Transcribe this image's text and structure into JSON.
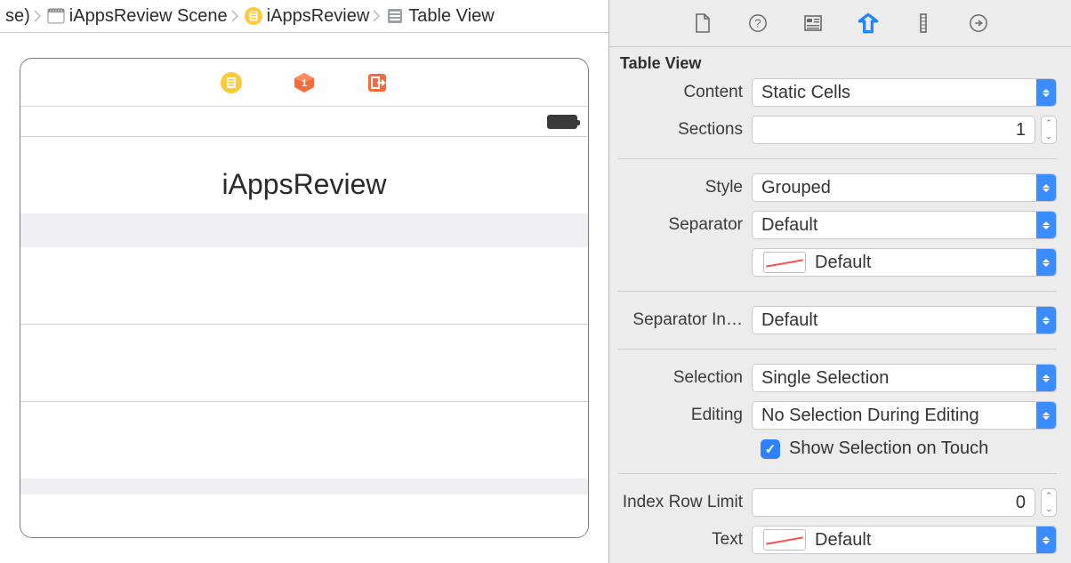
{
  "breadcrumbs": {
    "item0": "se)",
    "item1": "iAppsReview Scene",
    "item2": "iAppsReview",
    "item3": "Table View"
  },
  "scene": {
    "nav_title": "iAppsReview"
  },
  "inspector": {
    "header": "Table View",
    "labels": {
      "content": "Content",
      "sections": "Sections",
      "style": "Style",
      "separator": "Separator",
      "separator_inset": "Separator In…",
      "selection": "Selection",
      "editing": "Editing",
      "show_sel": "Show Selection on Touch",
      "index_row_limit": "Index Row Limit",
      "text": "Text"
    },
    "values": {
      "content": "Static Cells",
      "sections": "1",
      "style": "Grouped",
      "separator": "Default",
      "separator_color": "Default",
      "separator_inset": "Default",
      "selection": "Single Selection",
      "editing": "No Selection During Editing",
      "index_row_limit": "0",
      "text": "Default"
    }
  }
}
